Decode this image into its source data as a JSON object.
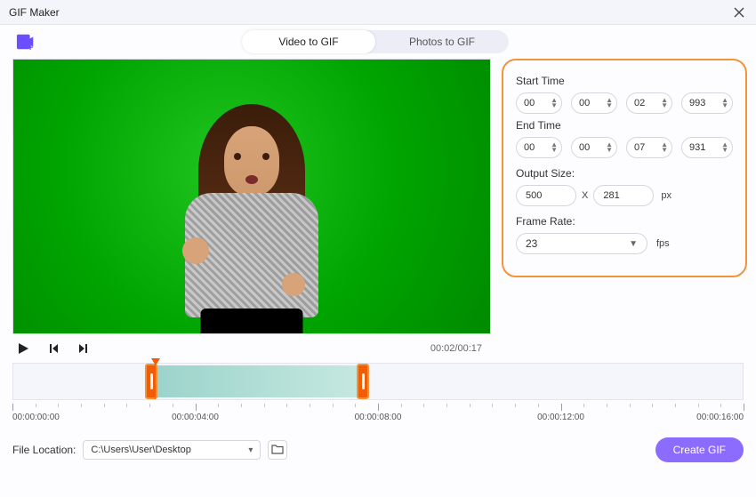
{
  "window": {
    "title": "GIF Maker"
  },
  "tabs": {
    "video": "Video to GIF",
    "photos": "Photos to GIF",
    "active": "video"
  },
  "panel": {
    "start_label": "Start Time",
    "end_label": "End Time",
    "start": {
      "h": "00",
      "m": "00",
      "s": "02",
      "ms": "993"
    },
    "end": {
      "h": "00",
      "m": "00",
      "s": "07",
      "ms": "931"
    },
    "output_label": "Output Size:",
    "output": {
      "w": "500",
      "h": "281",
      "sep": "X",
      "unit": "px"
    },
    "framerate_label": "Frame Rate:",
    "framerate": {
      "value": "23",
      "unit": "fps"
    }
  },
  "transport": {
    "current": "00:02",
    "total": "00:17"
  },
  "ruler": {
    "labels": [
      "00:00:00:00",
      "00:00:04:00",
      "00:00:08:00",
      "00:00:12:00",
      "00:00:16:00"
    ]
  },
  "bottom": {
    "label": "File Location:",
    "path": "C:\\Users\\User\\Desktop",
    "create": "Create GIF"
  }
}
